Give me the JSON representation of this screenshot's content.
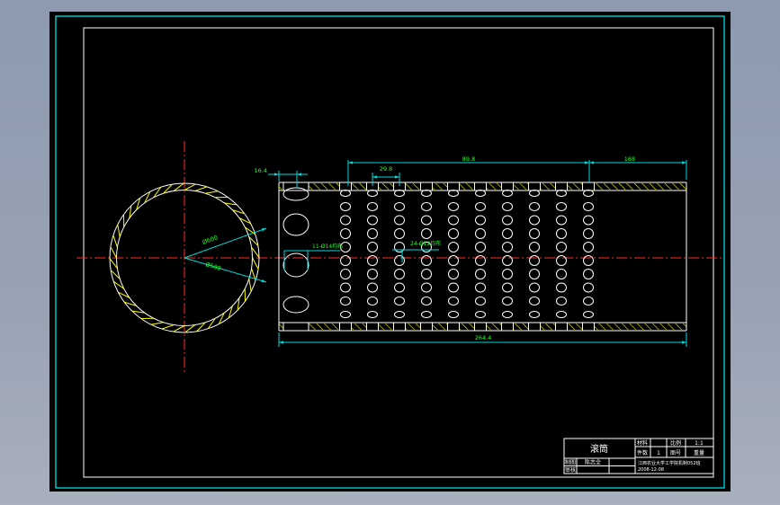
{
  "window": {
    "chrome_color_top": "#8d9ab0",
    "chrome_color_bottom": "#a8afbd",
    "canvas_color": "#000000"
  },
  "drawing": {
    "frame_color": "#00f2f2",
    "object_line_color": "#ffffff",
    "centerline_color": "#ff2d2d",
    "hatch_color": "#ffff00",
    "dimension_color": "#00dcdc",
    "dimension_text_color": "#22ff22",
    "dimensions": {
      "left_offset": "16.4",
      "hole_pitch": "29.8",
      "perforated_length": "89.8",
      "plain_length": "168",
      "total_length": "264.4",
      "outer_diameter": "Ø600",
      "inner_diameter": "Ø580"
    },
    "annotations": {
      "large_holes": "11-Ø14均布",
      "small_holes": "24-Ø12均布"
    }
  },
  "title_block": {
    "part_name": "滚筒",
    "material_label": "材料",
    "material_value": "",
    "scale_label": "比例",
    "scale_value": "1:1",
    "qty_label": "件数",
    "qty_value": "1",
    "drawing_no_label": "图号",
    "weight_label": "重量",
    "drawn_label": "制图",
    "drawn_by": "陈志全",
    "checked_label": "审核",
    "org_line": "江西农业大学工学院机制052班",
    "date_line": "2008-12-08"
  }
}
